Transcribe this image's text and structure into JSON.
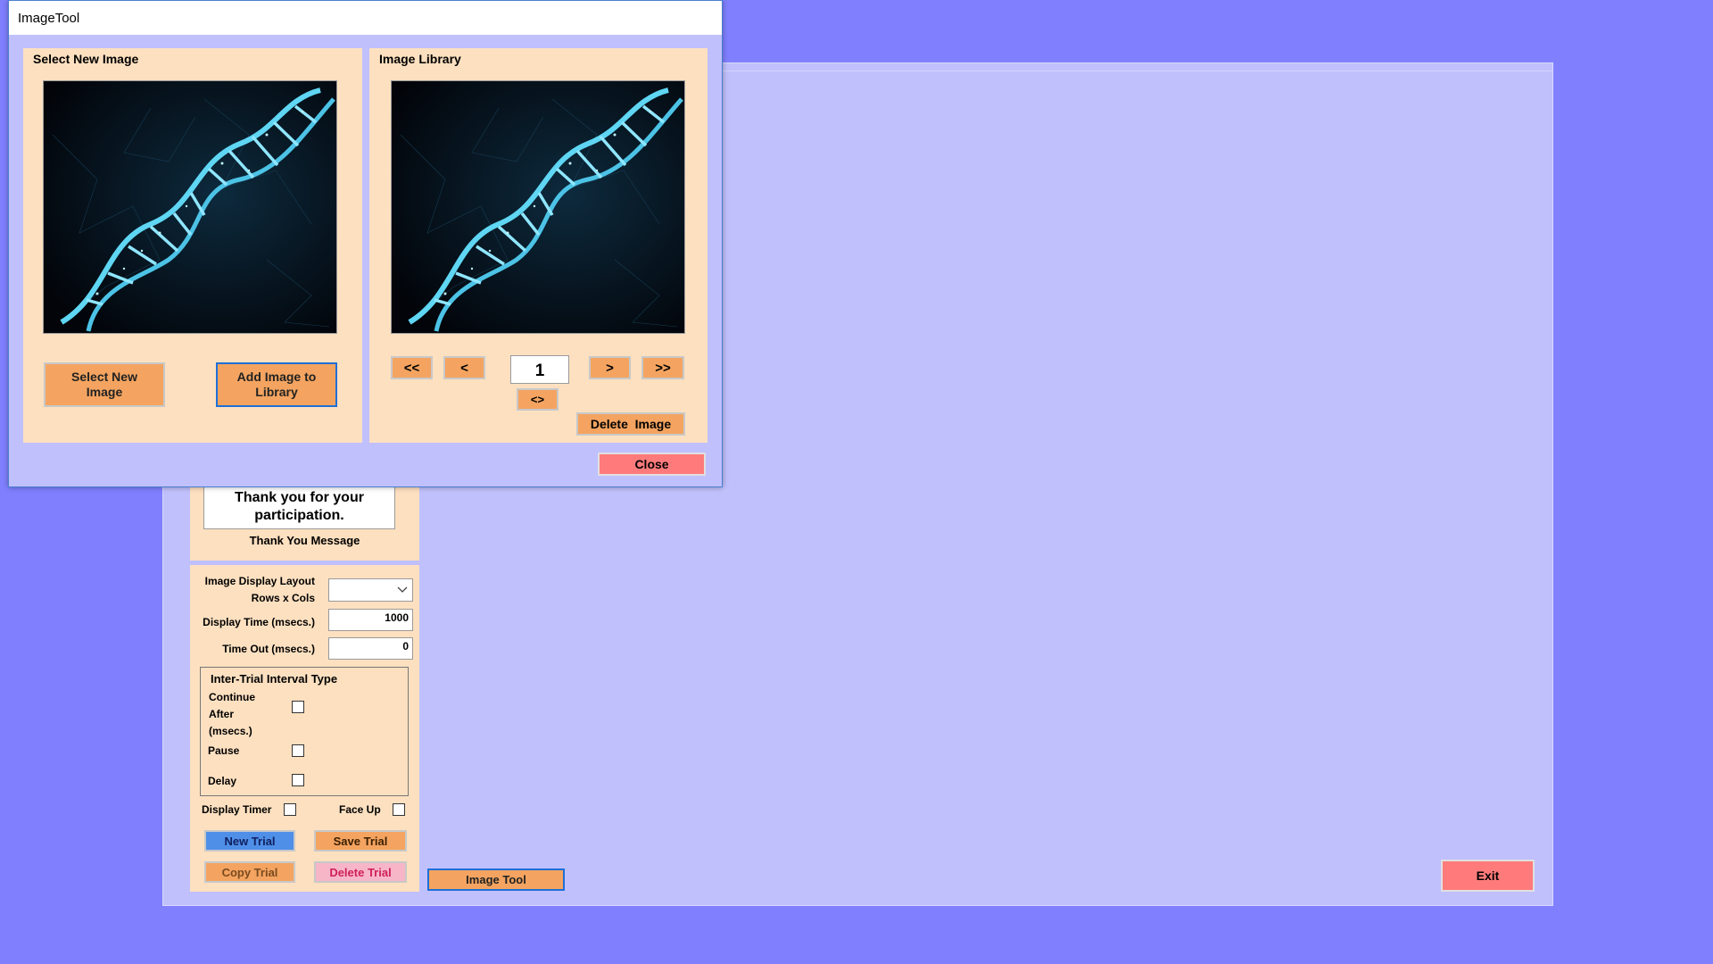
{
  "dialog": {
    "title": "ImageTool",
    "select_section": {
      "title": "Select New Image",
      "select_button": "Select New Image",
      "add_button": "Add Image to Library"
    },
    "library_section": {
      "title": "Image Library",
      "first_button": "<<",
      "prev_button": "<",
      "page_value": "1",
      "next_button": ">",
      "last_button": ">>",
      "toggle_button": "<>",
      "delete_button": "Delete  Image"
    },
    "close_button": "Close"
  },
  "thank_you": {
    "message": "Thank you for your participation.",
    "label": "Thank You Message"
  },
  "trial_settings": {
    "layout_label": "Image Display Layout Rows x Cols",
    "layout_value": "",
    "display_time_label": "Display Time (msecs.)",
    "display_time_value": "1000",
    "time_out_label": "Time Out (msecs.)",
    "time_out_value": "0",
    "iti_group": {
      "title": "Inter-Trial Interval Type",
      "continue_label": "Continue After (msecs.)",
      "pause_label": "Pause",
      "delay_label": "Delay"
    },
    "display_timer_label": "Display Timer",
    "face_up_label": "Face Up",
    "buttons": {
      "new_trial": "New Trial",
      "save_trial": "Save Trial",
      "copy_trial": "Copy Trial",
      "delete_trial": "Delete Trial"
    }
  },
  "image_tool_button": "Image Tool",
  "exit_button": "Exit",
  "colors": {
    "desktop": "#8080ff",
    "panel": "#c0c0fc",
    "section": "#fde0c0",
    "orange_button": "#f4a460",
    "blue_button": "#4f8fe8",
    "pink_button": "#f7b6c8",
    "close_red": "#ff7b7b"
  }
}
